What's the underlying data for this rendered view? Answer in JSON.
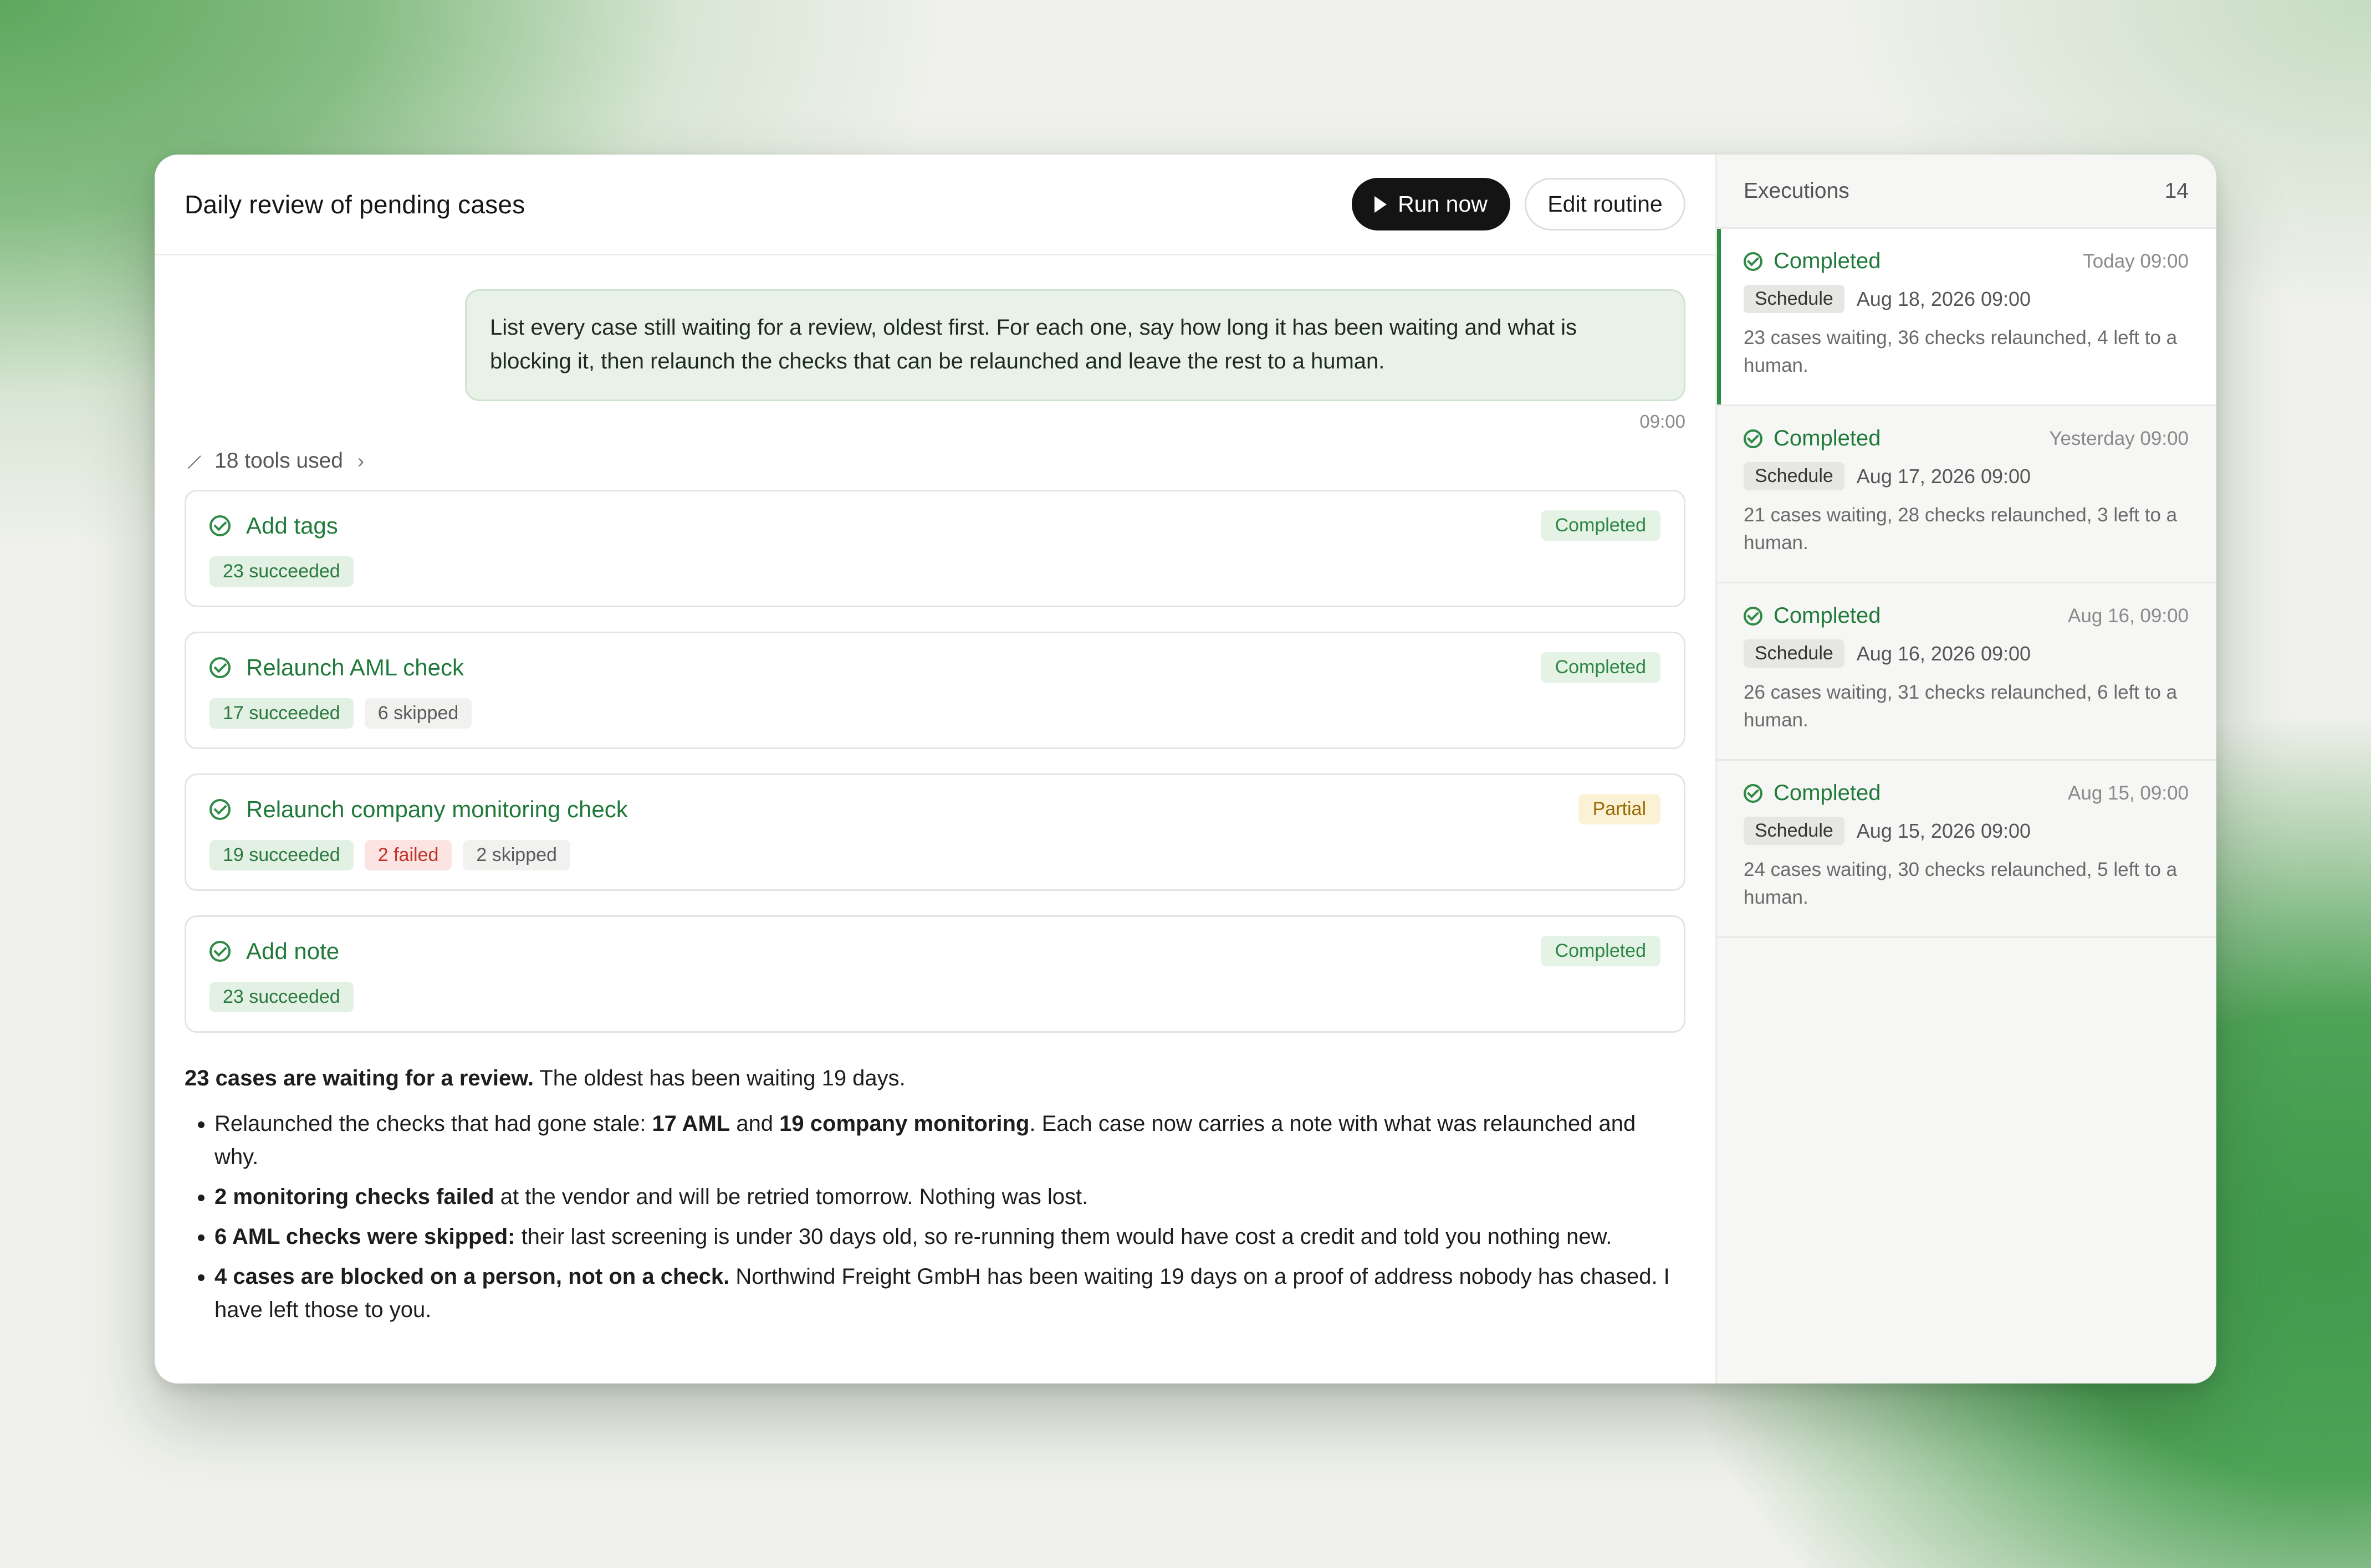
{
  "header": {
    "title": "Daily review of pending cases",
    "run_label": "Run now",
    "edit_label": "Edit routine"
  },
  "message": {
    "text": "List every case still waiting for a review, oldest first. For each one, say how long it has been waiting and what is blocking it, then relaunch the checks that can be relaunched and leave the rest to a human.",
    "time": "09:00"
  },
  "tools": {
    "label": "18 tools used",
    "cards": [
      {
        "name": "Add tags",
        "status": "Completed",
        "chips": [
          {
            "text": "23 succeeded",
            "kind": "green"
          }
        ]
      },
      {
        "name": "Relaunch AML check",
        "status": "Completed",
        "chips": [
          {
            "text": "17 succeeded",
            "kind": "green"
          },
          {
            "text": "6 skipped",
            "kind": "gray"
          }
        ]
      },
      {
        "name": "Relaunch company monitoring check",
        "status": "Partial",
        "chips": [
          {
            "text": "19 succeeded",
            "kind": "green"
          },
          {
            "text": "2 failed",
            "kind": "red"
          },
          {
            "text": "2 skipped",
            "kind": "gray"
          }
        ]
      },
      {
        "name": "Add note",
        "status": "Completed",
        "chips": [
          {
            "text": "23 succeeded",
            "kind": "green"
          }
        ]
      }
    ]
  },
  "summary": {
    "lead_bold": "23 cases are waiting for a review.",
    "lead_rest": " The oldest has been waiting 19 days.",
    "bullets": [
      {
        "parts": [
          {
            "t": "Relaunched the checks that had gone stale: "
          },
          {
            "t": "17 AML",
            "b": true
          },
          {
            "t": " and "
          },
          {
            "t": "19 company monitoring",
            "b": true
          },
          {
            "t": ". Each case now carries a note with what was relaunched and why."
          }
        ]
      },
      {
        "parts": [
          {
            "t": "2 monitoring checks failed",
            "b": true
          },
          {
            "t": " at the vendor and will be retried tomorrow. Nothing was lost."
          }
        ]
      },
      {
        "parts": [
          {
            "t": "6 AML checks were skipped:",
            "b": true
          },
          {
            "t": " their last screening is under 30 days old, so re-running them would have cost a credit and told you nothing new."
          }
        ]
      },
      {
        "parts": [
          {
            "t": "4 cases are blocked on a person, not on a check.",
            "b": true
          },
          {
            "t": " Northwind Freight GmbH has been waiting 19 days on a proof of address nobody has chased. I have left those to you."
          }
        ]
      }
    ]
  },
  "executions": {
    "label": "Executions",
    "count": "14",
    "items": [
      {
        "status": "Completed",
        "time": "Today 09:00",
        "badge": "Schedule",
        "date": "Aug 18, 2026 09:00",
        "desc": "23 cases waiting, 36 checks relaunched, 4 left to a human.",
        "active": true
      },
      {
        "status": "Completed",
        "time": "Yesterday 09:00",
        "badge": "Schedule",
        "date": "Aug 17, 2026 09:00",
        "desc": "21 cases waiting, 28 checks relaunched, 3 left to a human.",
        "active": false
      },
      {
        "status": "Completed",
        "time": "Aug 16, 09:00",
        "badge": "Schedule",
        "date": "Aug 16, 2026 09:00",
        "desc": "26 cases waiting, 31 checks relaunched, 6 left to a human.",
        "active": false
      },
      {
        "status": "Completed",
        "time": "Aug 15, 09:00",
        "badge": "Schedule",
        "date": "Aug 15, 2026 09:00",
        "desc": "24 cases waiting, 30 checks relaunched, 5 left to a human.",
        "active": false
      }
    ]
  }
}
